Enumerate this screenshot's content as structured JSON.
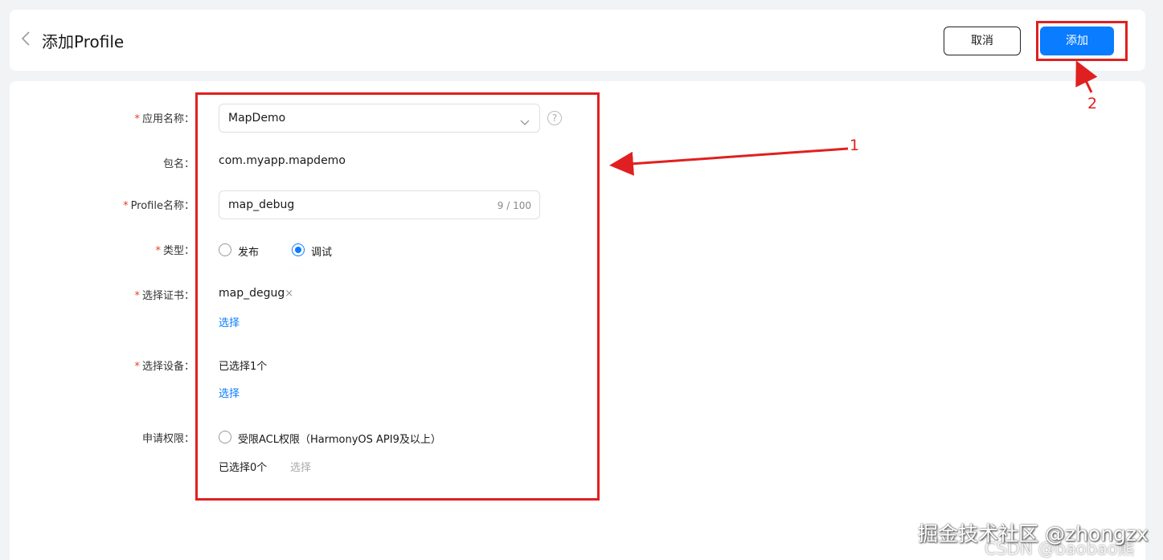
{
  "header": {
    "title": "添加Profile",
    "cancel_label": "取消",
    "add_label": "添加"
  },
  "form": {
    "app_name": {
      "label": "应用名称：",
      "value": "MapDemo"
    },
    "package": {
      "label": "包名：",
      "value": "com.myapp.mapdemo"
    },
    "profile_name": {
      "label": "Profile名称：",
      "value": "map_debug",
      "count": "9 / 100"
    },
    "type": {
      "label": "类型：",
      "options": [
        "发布",
        "调试"
      ],
      "selected": "调试"
    },
    "certificate": {
      "label": "选择证书：",
      "value": "map_degug",
      "remove": "×",
      "select_link": "选择"
    },
    "device": {
      "label": "选择设备：",
      "value": "已选择1个",
      "select_link": "选择"
    },
    "permission": {
      "label": "申请权限：",
      "option": "受限ACL权限（HarmonyOS API9及以上）",
      "selected_count": "已选择0个",
      "select_link": "选择"
    }
  },
  "annotations": {
    "label_1": "1",
    "label_2": "2"
  },
  "watermark": {
    "text": "掘金技术社区 @zhongzx",
    "text2": "CSDN @baobao熊"
  },
  "colors": {
    "primary": "#0a7cff",
    "required": "#e84026",
    "annotation": "#e02020"
  },
  "icons": [
    "back-chevron-icon",
    "chevron-down-icon",
    "help-icon",
    "close-icon"
  ]
}
